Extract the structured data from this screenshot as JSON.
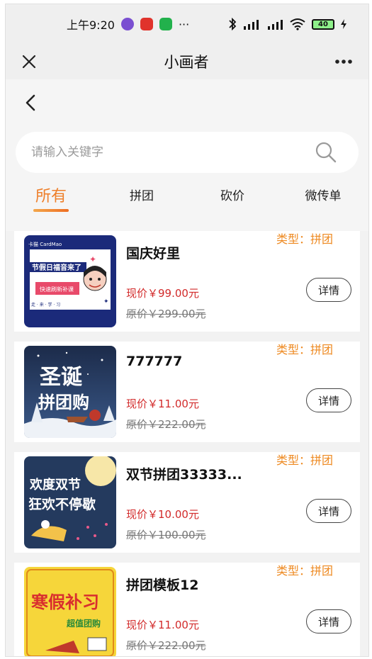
{
  "status_bar": {
    "time": "上午9:20",
    "more": "···",
    "battery": "40"
  },
  "title_bar": {
    "title": "小画者",
    "menu": "···"
  },
  "search": {
    "placeholder": "请输入关键字"
  },
  "tabs": [
    {
      "label": "所有",
      "active": true
    },
    {
      "label": "拼团",
      "active": false
    },
    {
      "label": "砍价",
      "active": false
    },
    {
      "label": "微传单",
      "active": false
    }
  ],
  "colors": {
    "accent": "#ee7f2a",
    "price": "#d22a2a"
  },
  "items": [
    {
      "type": "类型：拼团",
      "title": "国庆好里",
      "now_price": "现价￥99.00元",
      "orig_price": "原价￥299.00元",
      "detail": "详情",
      "thumb": {
        "line1": "节假日福音来了",
        "line2": "快速刷新补课",
        "brand": "卡猫 CardMao",
        "footer": "走 · 来 · 学 · 习"
      }
    },
    {
      "type": "类型：拼团",
      "title": "777777",
      "now_price": "现价￥11.00元",
      "orig_price": "原价￥222.00元",
      "detail": "详情",
      "thumb": {
        "line1": "圣诞",
        "line2": "拼团购"
      }
    },
    {
      "type": "类型：拼团",
      "title": "双节拼团33333...",
      "now_price": "现价￥10.00元",
      "orig_price": "原价￥100.00元",
      "detail": "详情",
      "thumb": {
        "line1": "欢度双节",
        "line2": "狂欢不停歇"
      }
    },
    {
      "type": "类型：拼团",
      "title": "拼团模板12",
      "now_price": "现价￥11.00元",
      "orig_price": "原价￥222.00元",
      "detail": "详情",
      "thumb": {
        "line1": "寒假补习",
        "line2": "超值团购"
      }
    }
  ]
}
